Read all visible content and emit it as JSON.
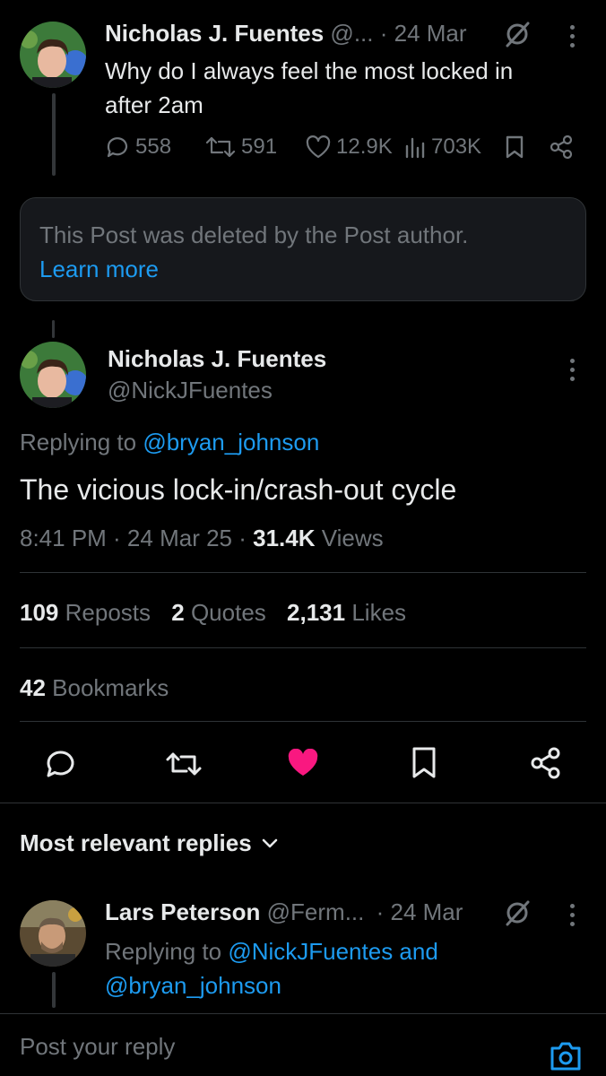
{
  "first_post": {
    "author_name": "Nicholas J. Fuentes",
    "handle": "@...",
    "date": "· 24 Mar",
    "text_line1": "Why do I always feel the most locked in",
    "text_line2": "after 2am",
    "replies": "558",
    "reposts": "591",
    "likes": "12.9K",
    "views": "703K"
  },
  "deleted_notice": {
    "text": "This Post was deleted by the Post author.",
    "link": "Learn more"
  },
  "main_post": {
    "author_name": "Nicholas J. Fuentes",
    "handle": "@NickJFuentes",
    "replying_prefix": "Replying to",
    "replying_handle": "@bryan_johnson",
    "text": "The vicious lock-in/crash-out cycle",
    "time": "8:41 PM · 24 Mar 25 ·",
    "views_count": "31.4K",
    "views_label": "Views",
    "reposts_count": "109",
    "reposts_label": "Reposts",
    "quotes_count": "2",
    "quotes_label": "Quotes",
    "likes_count": "2,131",
    "likes_label": "Likes",
    "bookmarks_count": "42",
    "bookmarks_label": "Bookmarks"
  },
  "replies_filter": {
    "label": "Most relevant replies"
  },
  "reply": {
    "author_name": "Lars Peterson",
    "handle": "@Ferm...",
    "date": "· 24 Mar",
    "replying_prefix": "Replying to",
    "replying_handle1": "@NickJFuentes and",
    "replying_handle2": "@bryan_johnson"
  },
  "composer": {
    "placeholder": "Post your reply"
  },
  "colors": {
    "background": "#000000",
    "accent": "#1d9bf0",
    "like_active": "#f91880",
    "muted": "#71767b"
  },
  "icons": {
    "reply": "speech-bubble-icon",
    "repost": "repost-arrows-icon",
    "like": "heart-icon",
    "views": "bar-chart-icon",
    "bookmark": "bookmark-icon",
    "share": "share-icon",
    "grok": "slash-circle-icon",
    "more": "vertical-dots-icon",
    "camera": "camera-icon"
  }
}
